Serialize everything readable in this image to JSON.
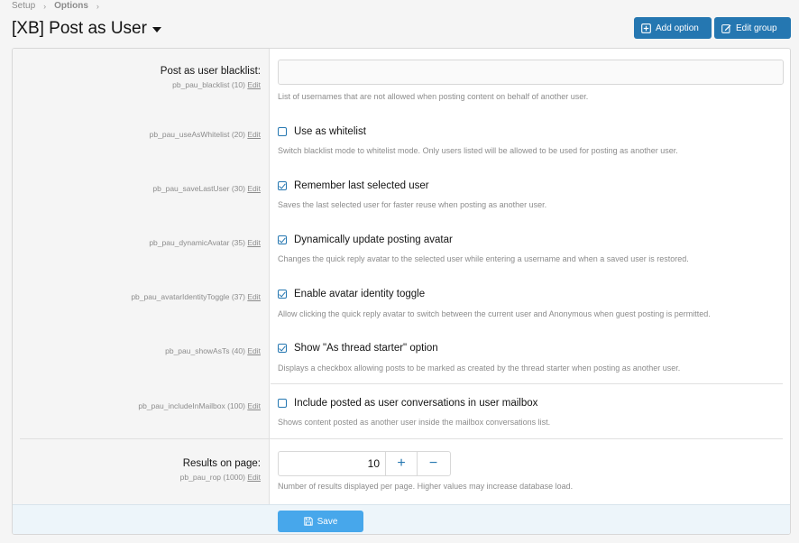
{
  "breadcrumb": {
    "items": [
      "Setup",
      "Options"
    ],
    "separator": "›"
  },
  "page": {
    "title": "[XB] Post as User"
  },
  "toolbar": {
    "add_option_label": "Add option",
    "edit_group_label": "Edit group"
  },
  "options": [
    {
      "label": "Post as user blacklist:",
      "key": "pb_pau_blacklist (10)",
      "edit": "Edit",
      "type": "text",
      "value": "",
      "hint": "List of usernames that are not allowed when posting content on behalf of another user."
    },
    {
      "label": "",
      "key": "pb_pau_useAsWhitelist (20)",
      "edit": "Edit",
      "type": "checkbox",
      "checked": false,
      "checkbox_label": "Use as whitelist",
      "hint": "Switch blacklist mode to whitelist mode. Only users listed will be allowed to be used for posting as another user."
    },
    {
      "label": "",
      "key": "pb_pau_saveLastUser (30)",
      "edit": "Edit",
      "type": "checkbox",
      "checked": true,
      "checkbox_label": "Remember last selected user",
      "hint": "Saves the last selected user for faster reuse when posting as another user."
    },
    {
      "label": "",
      "key": "pb_pau_dynamicAvatar (35)",
      "edit": "Edit",
      "type": "checkbox",
      "checked": true,
      "checkbox_label": "Dynamically update posting avatar",
      "hint": "Changes the quick reply avatar to the selected user while entering a username and when a saved user is restored."
    },
    {
      "label": "",
      "key": "pb_pau_avatarIdentityToggle (37)",
      "edit": "Edit",
      "type": "checkbox",
      "checked": true,
      "checkbox_label": "Enable avatar identity toggle",
      "hint": "Allow clicking the quick reply avatar to switch between the current user and Anonymous when guest posting is permitted."
    },
    {
      "label": "",
      "key": "pb_pau_showAsTs (40)",
      "edit": "Edit",
      "type": "checkbox",
      "checked": true,
      "checkbox_label": "Show \"As thread starter\" option",
      "hint": "Displays a checkbox allowing posts to be marked as created by the thread starter when posting as another user."
    },
    {
      "label": "",
      "key": "pb_pau_includeInMailbox (100)",
      "edit": "Edit",
      "type": "checkbox",
      "checked": false,
      "checkbox_label": "Include posted as user conversations in user mailbox",
      "hint": "Shows content posted as another user inside the mailbox conversations list."
    },
    {
      "label": "Results on page:",
      "key": "pb_pau_rop (1000)",
      "edit": "Edit",
      "type": "number",
      "value": "10",
      "plus": "+",
      "minus": "−",
      "hint": "Number of results displayed per page. Higher values may increase database load."
    }
  ],
  "footer": {
    "save_label": "Save"
  },
  "colors": {
    "accent": "#2577b1",
    "save_button": "#47a7eb",
    "footer_bg": "#edf5fa"
  }
}
